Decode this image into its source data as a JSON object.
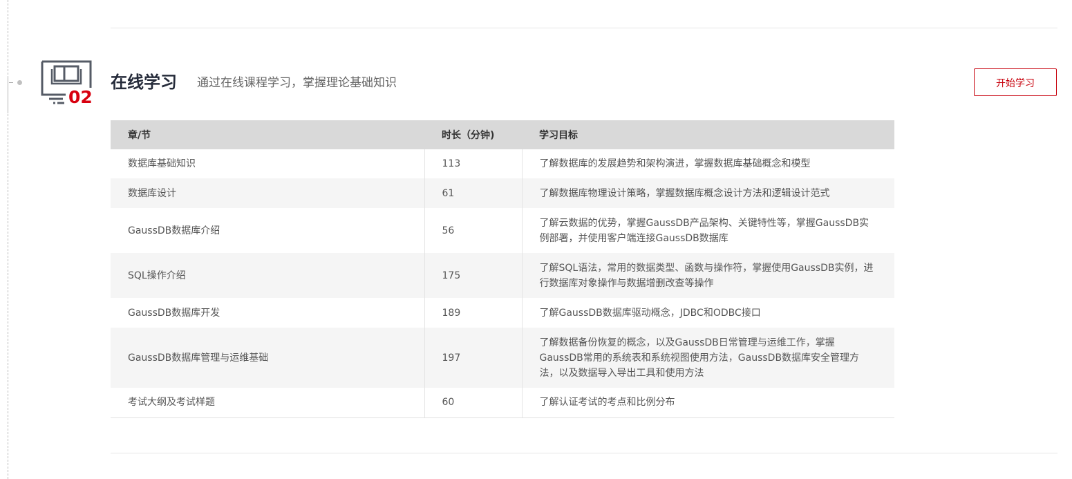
{
  "section": {
    "number": "02",
    "title": "在线学习",
    "subtitle": "通过在线课程学习，掌握理论基础知识",
    "start_button": "开始学习",
    "icon": "book-monitor-icon"
  },
  "colors": {
    "accent": "#c7000b",
    "header_bg": "#d9d9d9",
    "stripe_bg": "#f5f5f5",
    "title": "#252b3a"
  },
  "table": {
    "headers": [
      "章/节",
      "时长（分钟)",
      "学习目标"
    ],
    "rows": [
      {
        "chapter": "数据库基础知识",
        "duration": "113",
        "goal": "了解数据库的发展趋势和架构演进，掌握数据库基础概念和模型"
      },
      {
        "chapter": "数据库设计",
        "duration": "61",
        "goal": "了解数据库物理设计策略，掌握数据库概念设计方法和逻辑设计范式"
      },
      {
        "chapter": "GaussDB数据库介绍",
        "duration": "56",
        "goal": "了解云数据的优势，掌握GaussDB产品架构、关键特性等，掌握GaussDB实例部署，并使用客户端连接GaussDB数据库"
      },
      {
        "chapter": "SQL操作介绍",
        "duration": "175",
        "goal": "了解SQL语法，常用的数据类型、函数与操作符，掌握使用GaussDB实例，进行数据库对象操作与数据增删改查等操作"
      },
      {
        "chapter": "GaussDB数据库开发",
        "duration": "189",
        "goal": "了解GaussDB数据库驱动概念，JDBC和ODBC接口"
      },
      {
        "chapter": "GaussDB数据库管理与运维基础",
        "duration": "197",
        "goal": "了解数据备份恢复的概念，以及GaussDB日常管理与运维工作，掌握GaussDB常用的系统表和系统视图使用方法，GaussDB数据库安全管理方法，以及数据导入导出工具和使用方法"
      },
      {
        "chapter": "考试大纲及考试样题",
        "duration": "60",
        "goal": "了解认证考试的考点和比例分布"
      }
    ]
  }
}
